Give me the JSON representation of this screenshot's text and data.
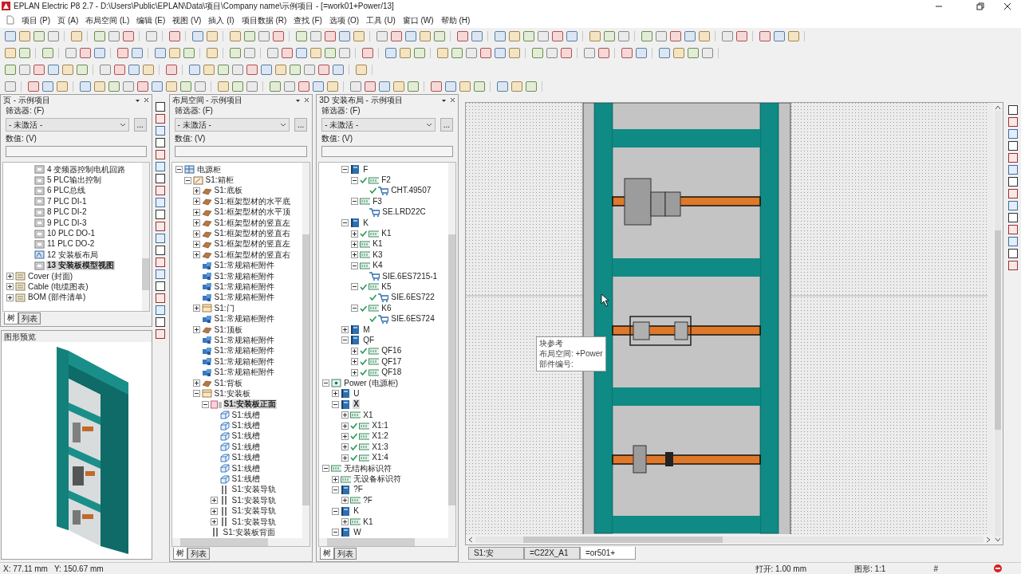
{
  "window": {
    "title": "EPLAN Electric P8 2.7 - D:\\Users\\Public\\EPLAN\\Data\\项目\\Company name\\示例项目 - [=work01+Power/13]"
  },
  "menu": [
    "项目 (P)",
    "页 (A)",
    "布局空间 (L)",
    "编辑 (E)",
    "视图 (V)",
    "插入 (I)",
    "项目数据 (R)",
    "查找 (F)",
    "选项 (O)",
    "工具 (U)",
    "窗口 (W)",
    "帮助 (H)"
  ],
  "panels": [
    {
      "title": "页 - 示例项目",
      "filter_label": "筛选器: (F)",
      "filter_value": "- 未激活 -",
      "more_button": "...",
      "value_label": "数值: (V)",
      "tabs": [
        {
          "label": "树",
          "selected": true
        },
        {
          "label": "列表",
          "selected": false
        }
      ],
      "tree": [
        {
          "children": [
            {
              "children": [
                {
                  "label": "4 变频器控制电机回路",
                  "kind": "page",
                  "selected": false
                },
                {
                  "label": "5 PLC输出控制",
                  "kind": "page",
                  "selected": false
                },
                {
                  "label": "6 PLC总线",
                  "kind": "page",
                  "selected": false
                },
                {
                  "label": "7 PLC DI-1",
                  "kind": "page",
                  "selected": false
                },
                {
                  "label": "8 PLC DI-2",
                  "kind": "page",
                  "selected": false
                },
                {
                  "label": "9 PLC DI-3",
                  "kind": "page",
                  "selected": false
                },
                {
                  "label": "10 PLC DO-1",
                  "kind": "page",
                  "selected": false
                },
                {
                  "label": "11 PLC DO-2",
                  "kind": "page",
                  "selected": false
                },
                {
                  "label": "12 安装板布局",
                  "kind": "layout",
                  "selected": false
                },
                {
                  "label": "13 安装板模型视图",
                  "kind": "page",
                  "selected": true
                }
              ]
            }
          ]
        },
        {
          "label": "Cover (封面)",
          "kind": "folder",
          "expanded": false,
          "selected": false
        },
        {
          "label": "Cable (电缆图表)",
          "kind": "folder",
          "expanded": false,
          "selected": false
        },
        {
          "label": "BOM (部件清单)",
          "kind": "folder",
          "expanded": false,
          "selected": false
        }
      ]
    },
    {
      "title": "布局空间 - 示例项目",
      "filter_label": "筛选器: (F)",
      "filter_value": "- 未激活 -",
      "more_button": "...",
      "value_label": "数值: (V)",
      "tabs": [
        {
          "label": "树",
          "selected": true
        },
        {
          "label": "列表",
          "selected": false
        }
      ],
      "tree": [
        {
          "label": "电源柜",
          "kind": "cabinet",
          "expanded": true,
          "selected": false,
          "children": [
            {
              "label": "S1:箱柜",
              "kind": "enclosure",
              "expanded": true,
              "selected": false,
              "children": [
                {
                  "label": "S1:底板",
                  "kind": "part",
                  "expanded": false,
                  "selected": false
                },
                {
                  "label": "S1:框架型材的水平底",
                  "kind": "part",
                  "expanded": false,
                  "selected": false
                },
                {
                  "label": "S1:框架型材的水平顶",
                  "kind": "part",
                  "expanded": false,
                  "selected": false
                },
                {
                  "label": "S1:框架型材的竖直左",
                  "kind": "part",
                  "expanded": false,
                  "selected": false
                },
                {
                  "label": "S1:框架型材的竖直右",
                  "kind": "part",
                  "expanded": false,
                  "selected": false
                },
                {
                  "label": "S1:框架型材的竖直左",
                  "kind": "part",
                  "expanded": false,
                  "selected": false
                },
                {
                  "label": "S1:框架型材的竖直右",
                  "kind": "part",
                  "expanded": false,
                  "selected": false
                },
                {
                  "label": "S1:常规箱柜附件",
                  "kind": "accessory",
                  "selected": false
                },
                {
                  "label": "S1:常规箱柜附件",
                  "kind": "accessory",
                  "selected": false
                },
                {
                  "label": "S1:常规箱柜附件",
                  "kind": "accessory",
                  "selected": false
                },
                {
                  "label": "S1:常规箱柜附件",
                  "kind": "accessory",
                  "selected": false
                },
                {
                  "label": "S1:门",
                  "kind": "door",
                  "expanded": false,
                  "selected": false
                },
                {
                  "label": "S1:常规箱柜附件",
                  "kind": "accessory",
                  "selected": false
                },
                {
                  "label": "S1:顶板",
                  "kind": "part",
                  "expanded": false,
                  "selected": false
                },
                {
                  "label": "S1:常规箱柜附件",
                  "kind": "accessory",
                  "selected": false
                },
                {
                  "label": "S1:常规箱柜附件",
                  "kind": "accessory",
                  "selected": false
                },
                {
                  "label": "S1:常规箱柜附件",
                  "kind": "accessory",
                  "selected": false
                },
                {
                  "label": "S1:常规箱柜附件",
                  "kind": "accessory",
                  "selected": false
                },
                {
                  "label": "S1:背板",
                  "kind": "part",
                  "expanded": false,
                  "selected": false
                },
                {
                  "label": "S1:安装板",
                  "kind": "door",
                  "expanded": true,
                  "selected": false,
                  "children": [
                    {
                      "label": "S1:安装板正面",
                      "kind": "face",
                      "expanded": true,
                      "selected": true,
                      "children": [
                        {
                          "label": "S1:线槽",
                          "kind": "duct",
                          "selected": false
                        },
                        {
                          "label": "S1:线槽",
                          "kind": "duct",
                          "selected": false
                        },
                        {
                          "label": "S1:线槽",
                          "kind": "duct",
                          "selected": false
                        },
                        {
                          "label": "S1:线槽",
                          "kind": "duct",
                          "selected": false
                        },
                        {
                          "label": "S1:线槽",
                          "kind": "duct",
                          "selected": false
                        },
                        {
                          "label": "S1:线槽",
                          "kind": "duct",
                          "selected": false
                        },
                        {
                          "label": "S1:线槽",
                          "kind": "duct",
                          "selected": false
                        },
                        {
                          "label": "S1:安装导轨",
                          "kind": "rail",
                          "selected": false
                        },
                        {
                          "label": "S1:安装导轨",
                          "kind": "rail",
                          "expanded": false,
                          "selected": false
                        },
                        {
                          "label": "S1:安装导轨",
                          "kind": "rail",
                          "expanded": false,
                          "selected": false
                        },
                        {
                          "label": "S1:安装导轨",
                          "kind": "rail",
                          "expanded": false,
                          "selected": false
                        }
                      ]
                    },
                    {
                      "label": "S1:安装板背面",
                      "kind": "rail",
                      "selected": false
                    }
                  ]
                }
              ]
            }
          ]
        }
      ]
    },
    {
      "title": "3D 安装布局 - 示例项目",
      "filter_label": "筛选器: (F)",
      "filter_value": "- 未激活 -",
      "more_button": "...",
      "value_label": "数值: (V)",
      "tabs": [
        {
          "label": "树",
          "selected": true
        },
        {
          "label": "列表",
          "selected": false
        }
      ],
      "tree": [
        {
          "children": [
            {
              "children": [
                {
                  "label": "F",
                  "kind": "device",
                  "expanded": true,
                  "checked": false,
                  "selected": false,
                  "children": [
                    {
                      "label": "F2",
                      "kind": "tag",
                      "expanded": true,
                      "checked": true,
                      "selected": false,
                      "children": [
                        {
                          "label": "CHT.49507",
                          "kind": "cart",
                          "checked": true,
                          "selected": false
                        }
                      ]
                    },
                    {
                      "label": "F3",
                      "kind": "tag",
                      "expanded": true,
                      "checked": false,
                      "selected": false,
                      "children": [
                        {
                          "label": "SE.LRD22C",
                          "kind": "cart",
                          "checked": false,
                          "selected": false
                        }
                      ]
                    }
                  ]
                },
                {
                  "label": "K",
                  "kind": "device",
                  "expanded": true,
                  "checked": false,
                  "selected": false,
                  "children": [
                    {
                      "label": "K1",
                      "kind": "tag",
                      "expanded": false,
                      "checked": true,
                      "selected": false
                    },
                    {
                      "label": "K1",
                      "kind": "tag",
                      "expanded": false,
                      "checked": false,
                      "selected": false
                    },
                    {
                      "label": "K3",
                      "kind": "tag",
                      "expanded": false,
                      "checked": false,
                      "selected": false
                    },
                    {
                      "label": "K4",
                      "kind": "tag",
                      "expanded": true,
                      "checked": false,
                      "selected": false,
                      "children": [
                        {
                          "label": "SIE.6ES7215-1",
                          "kind": "cart",
                          "checked": false,
                          "selected": false
                        }
                      ]
                    },
                    {
                      "label": "K5",
                      "kind": "tag",
                      "expanded": true,
                      "checked": true,
                      "selected": false,
                      "children": [
                        {
                          "label": "SIE.6ES722",
                          "kind": "cart",
                          "checked": true,
                          "selected": false
                        }
                      ]
                    },
                    {
                      "label": "K6",
                      "kind": "tag",
                      "expanded": true,
                      "checked": true,
                      "selected": false,
                      "children": [
                        {
                          "label": "SIE.6ES724",
                          "kind": "cart",
                          "checked": true,
                          "selected": false
                        }
                      ]
                    }
                  ]
                },
                {
                  "label": "M",
                  "kind": "device",
                  "expanded": false,
                  "checked": false,
                  "selected": false
                },
                {
                  "label": "QF",
                  "kind": "device",
                  "expanded": true,
                  "checked": false,
                  "selected": false,
                  "children": [
                    {
                      "label": "QF16",
                      "kind": "tag",
                      "expanded": false,
                      "checked": true,
                      "selected": false
                    },
                    {
                      "label": "QF17",
                      "kind": "tag",
                      "expanded": false,
                      "checked": true,
                      "selected": false
                    },
                    {
                      "label": "QF18",
                      "kind": "tag",
                      "expanded": false,
                      "checked": true,
                      "selected": false
                    }
                  ]
                }
              ]
            }
          ]
        },
        {
          "label": "Power (电源柜)",
          "kind": "location",
          "expanded": true,
          "checked": false,
          "selected": false,
          "children": [
            {
              "label": "U",
              "kind": "device",
              "expanded": false,
              "checked": false,
              "selected": false
            },
            {
              "label": "X",
              "kind": "device",
              "expanded": true,
              "checked": false,
              "selected": true,
              "children": [
                {
                  "label": "X1",
                  "kind": "tag",
                  "expanded": false,
                  "checked": false,
                  "selected": false
                },
                {
                  "label": "X1:1",
                  "kind": "tag",
                  "expanded": false,
                  "checked": true,
                  "selected": false
                },
                {
                  "label": "X1:2",
                  "kind": "tag",
                  "expanded": false,
                  "checked": true,
                  "selected": false
                },
                {
                  "label": "X1:3",
                  "kind": "tag",
                  "expanded": false,
                  "checked": true,
                  "selected": false
                },
                {
                  "label": "X1:4",
                  "kind": "tag",
                  "expanded": false,
                  "checked": true,
                  "selected": false
                }
              ]
            }
          ]
        },
        {
          "label": "无结构标识符",
          "kind": "tag",
          "expanded": true,
          "checked": false,
          "selected": false,
          "children": [
            {
              "label": "无设备标识符",
              "kind": "tag",
              "expanded": false,
              "checked": false,
              "selected": false
            },
            {
              "label": "?F",
              "kind": "device",
              "expanded": true,
              "checked": false,
              "selected": false,
              "children": [
                {
                  "label": "?F",
                  "kind": "tag",
                  "expanded": false,
                  "checked": false,
                  "selected": false
                }
              ]
            },
            {
              "label": "K",
              "kind": "device",
              "expanded": true,
              "checked": false,
              "selected": false,
              "children": [
                {
                  "label": "K1",
                  "kind": "tag",
                  "expanded": false,
                  "checked": false,
                  "selected": false
                }
              ]
            },
            {
              "label": "W",
              "kind": "device",
              "expanded": true,
              "checked": false,
              "selected": false
            }
          ]
        }
      ]
    }
  ],
  "preview": {
    "title": "图形预览"
  },
  "canvas": {
    "tooltip": [
      "块参考",
      "布局空间: +Power",
      "部件编号:"
    ],
    "tabs": [
      {
        "label": "S1:安",
        "selected": false
      },
      {
        "label": "=C22X_A1",
        "selected": false
      },
      {
        "label": "=or501+",
        "selected": true
      }
    ]
  },
  "status_bar": {
    "x": "X: 77.11 mm",
    "y": "Y: 150.67 mm",
    "snap": "打开: 1.00 mm",
    "scale": "图形: 1:1",
    "grid": "#"
  }
}
